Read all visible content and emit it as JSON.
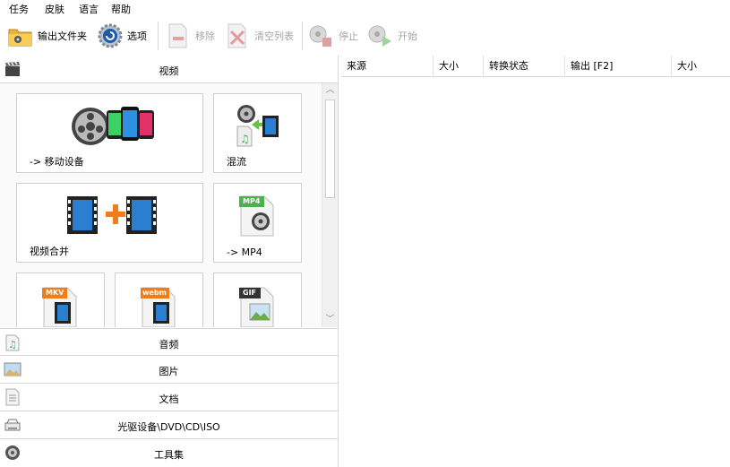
{
  "menu": {
    "items": [
      "任务",
      "皮肤",
      "语言",
      "帮助"
    ]
  },
  "toolbar": {
    "output_folder": "输出文件夹",
    "options": "选项",
    "remove": "移除",
    "clear_list": "清空列表",
    "stop": "停止",
    "start": "开始"
  },
  "categories": {
    "video": "视频",
    "audio": "音频",
    "picture": "图片",
    "document": "文档",
    "optical": "光驱设备\\DVD\\CD\\ISO",
    "tools": "工具集"
  },
  "tiles": {
    "mobile": "-> 移动设备",
    "mux": "混流",
    "join": "视频合并",
    "mp4": "-> MP4",
    "mp4_badge": "MP4",
    "mkv_badge": "MKV",
    "webm_badge": "webm",
    "gif_badge": "GIF"
  },
  "grid": {
    "columns": [
      "来源",
      "大小",
      "转换状态",
      "输出 [F2]",
      "大小"
    ]
  },
  "colors": {
    "accent_orange": "#f07d1a",
    "mp4_green": "#4caf50",
    "film_blue": "#2a7fd1"
  }
}
